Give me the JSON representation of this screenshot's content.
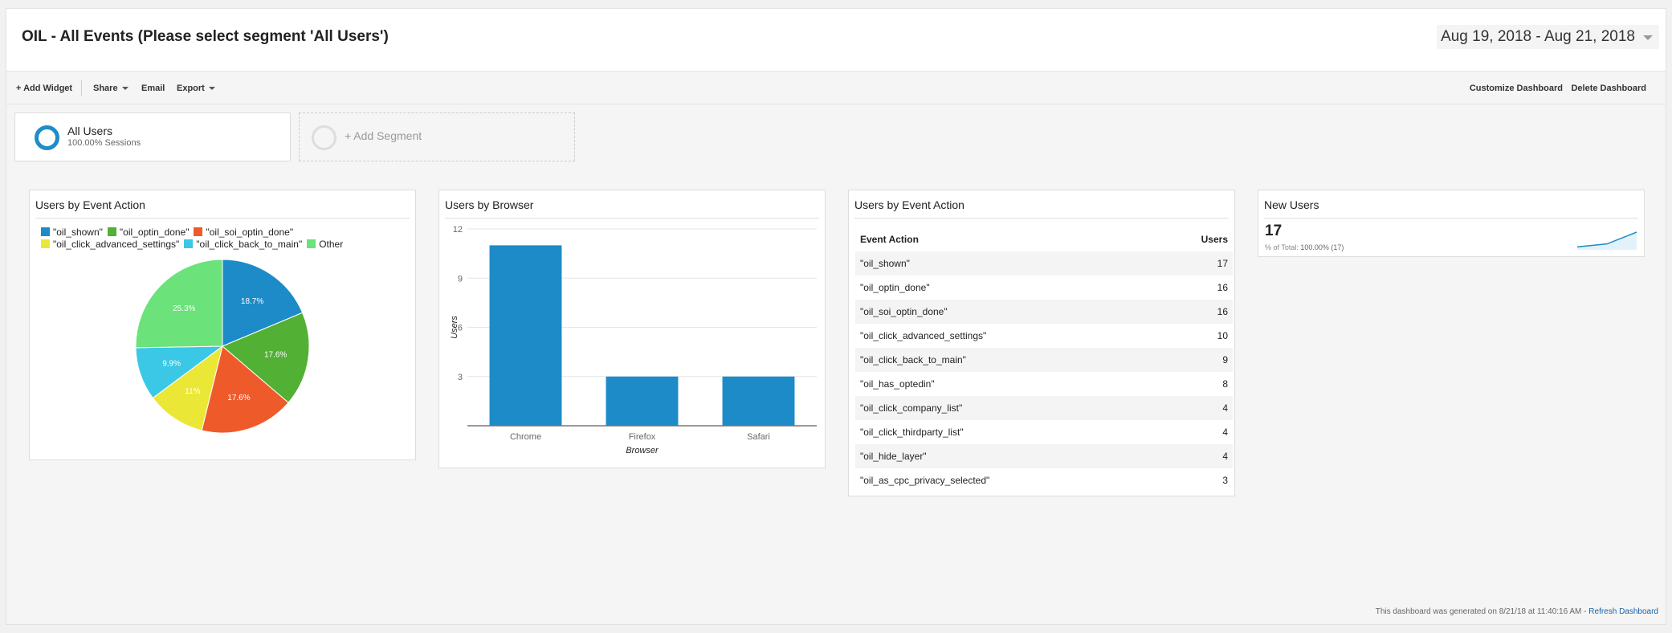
{
  "header": {
    "title": "OIL - All Events (Please select segment 'All Users')",
    "date_range": "Aug 19, 2018 - Aug 21, 2018"
  },
  "toolbar": {
    "add_widget": "+ Add Widget",
    "share": "Share",
    "email": "Email",
    "export": "Export",
    "customize": "Customize Dashboard",
    "delete": "Delete Dashboard"
  },
  "segments": {
    "all_users": {
      "name": "All Users",
      "sub": "100.00% Sessions",
      "color": "#1e8dc8"
    },
    "add_segment": "+ Add Segment"
  },
  "widgets": {
    "pie": {
      "title": "Users by Event Action",
      "legend": [
        {
          "label": "\"oil_shown\"",
          "color": "#1c8bc7"
        },
        {
          "label": "\"oil_optin_done\"",
          "color": "#52b035"
        },
        {
          "label": "\"oil_soi_optin_done\"",
          "color": "#ef5a2a"
        },
        {
          "label": "\"oil_click_advanced_settings\"",
          "color": "#ebe737"
        },
        {
          "label": "\"oil_click_back_to_main\"",
          "color": "#3ac8e6"
        },
        {
          "label": "Other",
          "color": "#6be27a"
        }
      ]
    },
    "bar": {
      "title": "Users by Browser"
    },
    "table": {
      "title": "Users by Event Action",
      "col_action": "Event Action",
      "col_users": "Users",
      "rows": [
        {
          "action": "\"oil_shown\"",
          "users": "17"
        },
        {
          "action": "\"oil_optin_done\"",
          "users": "16"
        },
        {
          "action": "\"oil_soi_optin_done\"",
          "users": "16"
        },
        {
          "action": "\"oil_click_advanced_settings\"",
          "users": "10"
        },
        {
          "action": "\"oil_click_back_to_main\"",
          "users": "9"
        },
        {
          "action": "\"oil_has_optedin\"",
          "users": "8"
        },
        {
          "action": "\"oil_click_company_list\"",
          "users": "4"
        },
        {
          "action": "\"oil_click_thirdparty_list\"",
          "users": "4"
        },
        {
          "action": "\"oil_hide_layer\"",
          "users": "4"
        },
        {
          "action": "\"oil_as_cpc_privacy_selected\"",
          "users": "3"
        }
      ]
    },
    "new_users": {
      "title": "New Users",
      "value": "17",
      "pct_label": "% of Total:",
      "pct_value": "100.00% (17)",
      "sparkline": [
        1,
        2,
        6
      ]
    }
  },
  "chart_data": [
    {
      "type": "pie",
      "title": "Users by Event Action",
      "categories": [
        "\"oil_shown\"",
        "\"oil_optin_done\"",
        "\"oil_soi_optin_done\"",
        "\"oil_click_advanced_settings\"",
        "\"oil_click_back_to_main\"",
        "Other"
      ],
      "values": [
        18.7,
        17.6,
        17.6,
        11,
        9.9,
        25.3
      ],
      "labels": [
        "18.7%",
        "17.6%",
        "17.6%",
        "11%",
        "9.9%",
        "25.3%"
      ],
      "colors": [
        "#1c8bc7",
        "#52b035",
        "#ef5a2a",
        "#ebe737",
        "#3ac8e6",
        "#6be27a"
      ],
      "legend_position": "top"
    },
    {
      "type": "bar",
      "title": "Users by Browser",
      "categories": [
        "Chrome",
        "Firefox",
        "Safari"
      ],
      "values": [
        11,
        3,
        3
      ],
      "xlabel": "Browser",
      "ylabel": "Users",
      "ylim": [
        0,
        12
      ],
      "yticks": [
        3,
        6,
        9,
        12
      ],
      "color": "#1c8bc7",
      "grid": true
    }
  ],
  "footer": {
    "text": "This dashboard was generated on 8/21/18 at 11:40:16 AM -",
    "link": "Refresh Dashboard"
  }
}
